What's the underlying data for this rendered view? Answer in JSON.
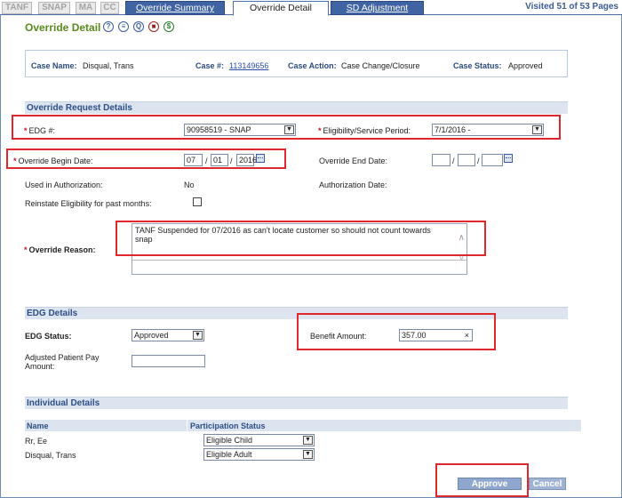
{
  "tabs": {
    "programs": [
      "TANF",
      "SNAP",
      "MA",
      "CC"
    ],
    "override_summary": "Override Summary",
    "override_detail": "Override Detail",
    "sd_adjustment": "SD Adjustment"
  },
  "visited": "Visited 51 of 53 Pages",
  "page_title": "Override Detail",
  "header_icons": [
    "help-icon",
    "notes-icon",
    "query-icon",
    "stop-icon",
    "dollar-icon"
  ],
  "case": {
    "name_label": "Case Name:",
    "name_value": "Disqual, Trans",
    "number_label": "Case #:",
    "number_value": "113149656",
    "action_label": "Case Action:",
    "action_value": "Case Change/Closure",
    "status_label": "Case Status:",
    "status_value": "Approved"
  },
  "override_request": {
    "section_title": "Override Request Details",
    "edg_label": "EDG #:",
    "edg_value": "90958519 - SNAP",
    "elig_period_label": "Eligibility/Service Period:",
    "elig_period_value": "7/1/2016 -",
    "begin_date_label": "Override Begin Date:",
    "begin_month": "07",
    "begin_day": "01",
    "begin_year": "2016",
    "end_date_label": "Override End Date:",
    "end_month": "",
    "end_day": "",
    "end_year": "",
    "used_auth_label": "Used in Authorization:",
    "used_auth_value": "No",
    "auth_date_label": "Authorization Date:",
    "reinstate_label": "Reinstate Eligibility for past months:",
    "reason_label": "Override Reason:",
    "reason_value": "TANF Suspended for  07/2016 as can't locate customer so should not count towards snap"
  },
  "edg_details": {
    "section_title": "EDG Details",
    "status_label": "EDG Status:",
    "status_value": "Approved",
    "benefit_label": "Benefit Amount:",
    "benefit_value": "357.00",
    "adjusted_label_1": "Adjusted Patient Pay",
    "adjusted_label_2": "Amount:",
    "adjusted_value": ""
  },
  "individual_details": {
    "section_title": "Individual Details",
    "col_name": "Name",
    "col_status": "Participation Status",
    "rows": [
      {
        "name": "Rr, Ee",
        "status": "Eligible Child"
      },
      {
        "name": "Disqual, Trans",
        "status": "Eligible Adult"
      }
    ]
  },
  "buttons": {
    "approve": "Approve",
    "cancel": "Cancel"
  },
  "colors": {
    "tab_blue": "#3f63a3",
    "title_green": "#5a8a1e",
    "section_bg": "#dbe4ef",
    "highlight_red": "#e0282c",
    "required_red": "#c8102e"
  }
}
